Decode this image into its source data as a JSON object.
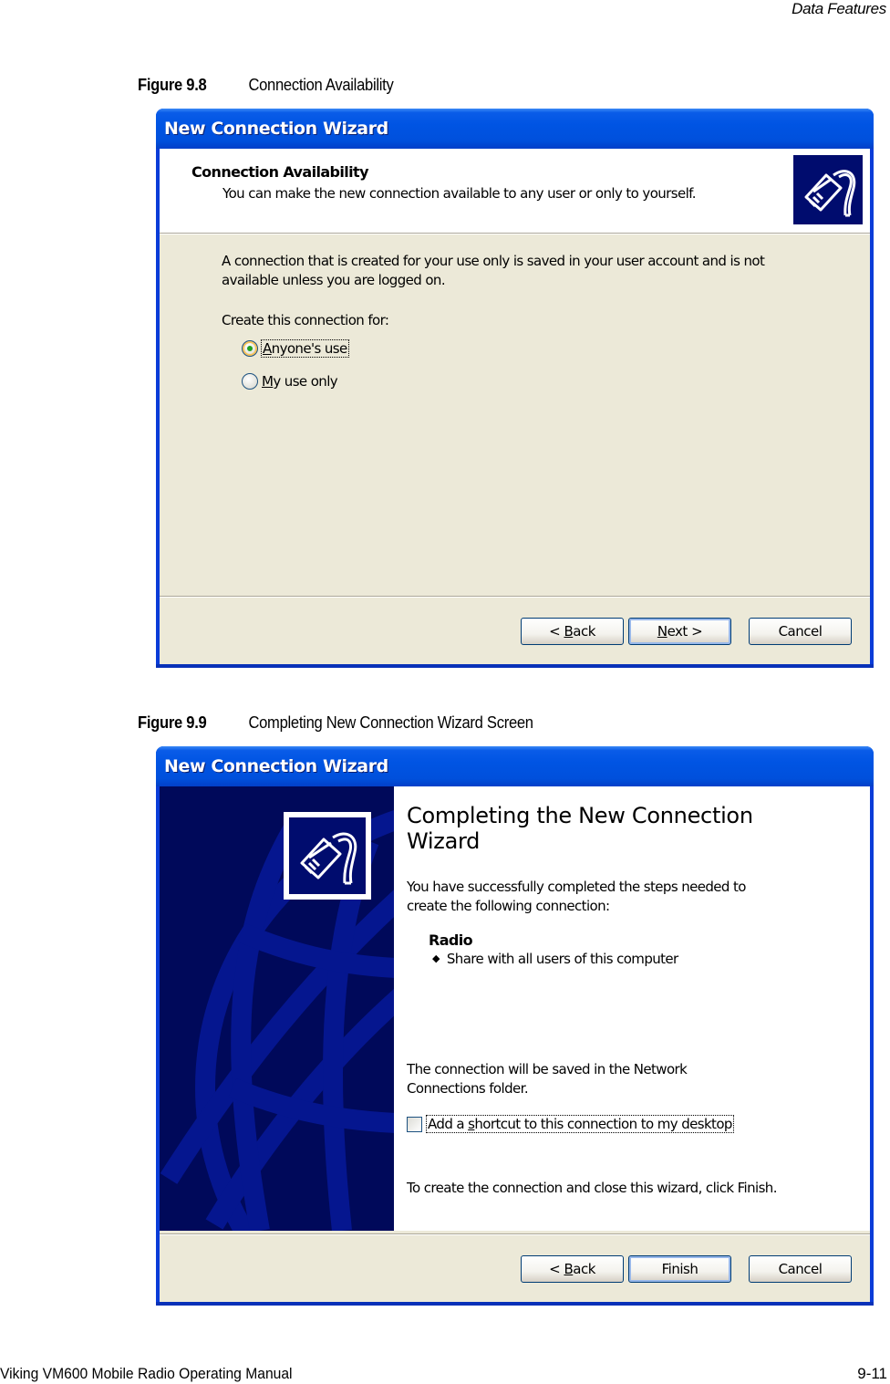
{
  "page": {
    "running_header": "Data Features",
    "footer_left": "Viking VM600 Mobile Radio Operating Manual",
    "footer_right": "9-11"
  },
  "figures": [
    {
      "number": "Figure 9.8",
      "caption": "Connection Availability",
      "window": {
        "title": "New Connection Wizard",
        "header_title": "Connection Availability",
        "header_subtitle": "You can make the new connection available to any user or only to yourself.",
        "header_icon": "network-cable-icon",
        "description_line1": "A connection that is created for your use only is saved in your user account and is not",
        "description_line2": "available unless you are logged on.",
        "group_label": "Create this connection for:",
        "options": [
          {
            "label_accel": "A",
            "label_rest": "nyone's use",
            "label": "Anyone's use",
            "selected": true
          },
          {
            "label_accel": "M",
            "label_rest": "y use only",
            "label": "My use only",
            "selected": false
          }
        ],
        "buttons": {
          "back": {
            "prefix": "< ",
            "accel": "B",
            "rest": "ack"
          },
          "next": {
            "accel": "N",
            "rest": "ext >"
          },
          "cancel": "Cancel"
        }
      }
    },
    {
      "number": "Figure 9.9",
      "caption": "Completing New Connection Wizard Screen",
      "window": {
        "title": "New Connection Wizard",
        "side_icon": "network-cable-icon",
        "heading_line1": "Completing the New Connection",
        "heading_line2": "Wizard",
        "intro_line1": "You have successfully completed the steps needed to",
        "intro_line2": "create the following connection:",
        "connection_name": "Radio",
        "connection_details": [
          "Share with all users of this computer"
        ],
        "save_note_line1": "The connection will be saved in the Network",
        "save_note_line2": "Connections folder.",
        "shortcut_checkbox": {
          "pre": "Add a ",
          "accel": "s",
          "rest": "hortcut to this connection to my desktop",
          "label": "Add a shortcut to this connection to my desktop",
          "checked": false
        },
        "finish_note": "To create the connection and close this wizard, click Finish.",
        "buttons": {
          "back": {
            "prefix": "< ",
            "accel": "B",
            "rest": "ack"
          },
          "finish": "Finish",
          "cancel": "Cancel"
        }
      }
    }
  ]
}
